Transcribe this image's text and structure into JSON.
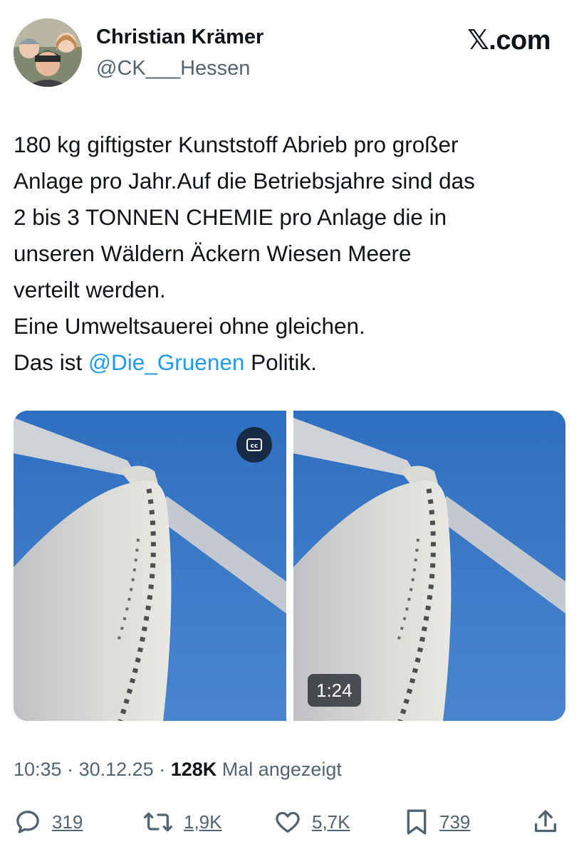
{
  "author": {
    "name": "Christian Krämer",
    "handle": "@CK___Hessen",
    "avatar_icon": "family-photo-avatar"
  },
  "brand": "𝕏.com",
  "tweet": {
    "lines": [
      "180 kg giftigster Kunststoff Abrieb pro großer",
      "Anlage pro Jahr.Auf die Betriebsjahre sind das",
      "2 bis 3 TONNEN CHEMIE pro Anlage die in",
      "unseren Wäldern Äckern Wiesen Meere",
      "verteilt werden.",
      "Eine Umweltsauerei ohne gleichen."
    ],
    "last_line_prefix": "Das ist ",
    "mention": "@Die_Gruenen",
    "last_line_suffix": " Politik.",
    "mention_color": "#1d9bf0"
  },
  "media": {
    "left_image": "wind-turbine-blade-erosion-closeup",
    "right_image": "wind-turbine-blade-erosion-closeup",
    "cc_icon": "closed-captions-icon",
    "duration": "1:24"
  },
  "meta": {
    "time": "10:35",
    "date": "30.12.25",
    "views": "128K",
    "views_label": "Mal angezeigt"
  },
  "actions": {
    "replies": "319",
    "reposts": "1,9K",
    "likes": "5,7K",
    "bookmarks": "739"
  }
}
